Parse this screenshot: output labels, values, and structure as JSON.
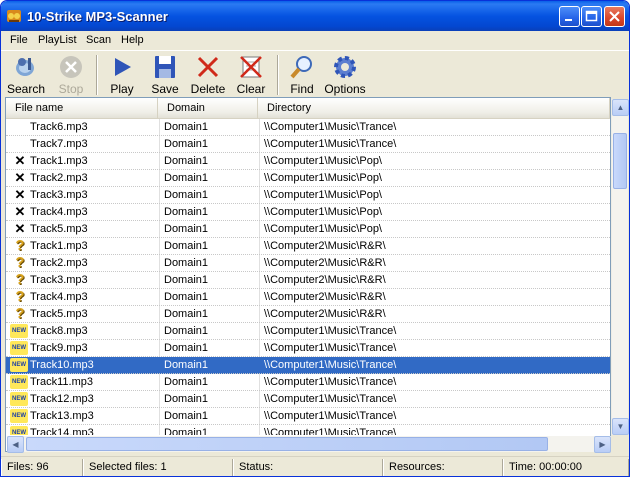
{
  "window": {
    "title": "10-Strike MP3-Scanner"
  },
  "menu": [
    "File",
    "PlayList",
    "Scan",
    "Help"
  ],
  "toolbar": {
    "search": "Search",
    "stop": "Stop",
    "play": "Play",
    "save": "Save",
    "delete": "Delete",
    "clear": "Clear",
    "find": "Find",
    "options": "Options"
  },
  "columns": {
    "name": "File name",
    "domain": "Domain",
    "dir": "Directory"
  },
  "rows": [
    {
      "icon": "none",
      "name": "Track6.mp3",
      "domain": "Domain1",
      "dir": "\\\\Computer1\\Music\\Trance\\"
    },
    {
      "icon": "none",
      "name": "Track7.mp3",
      "domain": "Domain1",
      "dir": "\\\\Computer1\\Music\\Trance\\"
    },
    {
      "icon": "cross",
      "name": "Track1.mp3",
      "domain": "Domain1",
      "dir": "\\\\Computer1\\Music\\Pop\\"
    },
    {
      "icon": "cross",
      "name": "Track2.mp3",
      "domain": "Domain1",
      "dir": "\\\\Computer1\\Music\\Pop\\"
    },
    {
      "icon": "cross",
      "name": "Track3.mp3",
      "domain": "Domain1",
      "dir": "\\\\Computer1\\Music\\Pop\\"
    },
    {
      "icon": "cross",
      "name": "Track4.mp3",
      "domain": "Domain1",
      "dir": "\\\\Computer1\\Music\\Pop\\"
    },
    {
      "icon": "cross",
      "name": "Track5.mp3",
      "domain": "Domain1",
      "dir": "\\\\Computer1\\Music\\Pop\\"
    },
    {
      "icon": "question",
      "name": "Track1.mp3",
      "domain": "Domain1",
      "dir": "\\\\Computer2\\Music\\R&R\\"
    },
    {
      "icon": "question",
      "name": "Track2.mp3",
      "domain": "Domain1",
      "dir": "\\\\Computer2\\Music\\R&R\\"
    },
    {
      "icon": "question",
      "name": "Track3.mp3",
      "domain": "Domain1",
      "dir": "\\\\Computer2\\Music\\R&R\\"
    },
    {
      "icon": "question",
      "name": "Track4.mp3",
      "domain": "Domain1",
      "dir": "\\\\Computer2\\Music\\R&R\\"
    },
    {
      "icon": "question",
      "name": "Track5.mp3",
      "domain": "Domain1",
      "dir": "\\\\Computer2\\Music\\R&R\\"
    },
    {
      "icon": "new",
      "name": "Track8.mp3",
      "domain": "Domain1",
      "dir": "\\\\Computer1\\Music\\Trance\\"
    },
    {
      "icon": "new",
      "name": "Track9.mp3",
      "domain": "Domain1",
      "dir": "\\\\Computer1\\Music\\Trance\\"
    },
    {
      "icon": "new",
      "name": "Track10.mp3",
      "domain": "Domain1",
      "dir": "\\\\Computer1\\Music\\Trance\\",
      "selected": true
    },
    {
      "icon": "new",
      "name": "Track11.mp3",
      "domain": "Domain1",
      "dir": "\\\\Computer1\\Music\\Trance\\"
    },
    {
      "icon": "new",
      "name": "Track12.mp3",
      "domain": "Domain1",
      "dir": "\\\\Computer1\\Music\\Trance\\"
    },
    {
      "icon": "new",
      "name": "Track13.mp3",
      "domain": "Domain1",
      "dir": "\\\\Computer1\\Music\\Trance\\"
    },
    {
      "icon": "new",
      "name": "Track14.mp3",
      "domain": "Domain1",
      "dir": "\\\\Computer1\\Music\\Trance\\"
    }
  ],
  "status": {
    "files": "Files: 96",
    "selected": "Selected files: 1",
    "status": "Status:",
    "resources": "Resources:",
    "time": "Time: 00:00:00"
  },
  "icons": {
    "new_badge": "NEW",
    "question": "?",
    "cross": "✕"
  },
  "colors": {
    "selection": "#316ac5",
    "titlebar": "#0553e1",
    "close": "#d9452a"
  }
}
